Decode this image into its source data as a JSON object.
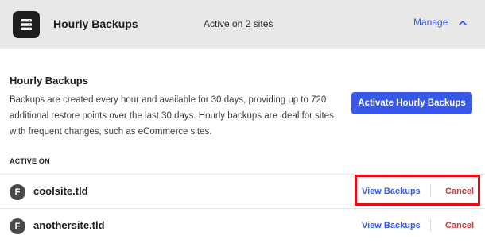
{
  "header": {
    "icon": "server-stack-icon",
    "title": "Hourly Backups",
    "active_summary": "Active on 2 sites",
    "manage_label": "Manage",
    "manage_icon": "chevron-up-icon"
  },
  "description": {
    "title": "Hourly Backups",
    "text": "Backups are created every hour and available for 30 days, providing up to 720 additional restore points over the last 30 days. Hourly backups are ideal for sites with frequent changes, such as eCommerce sites.",
    "activate_label": "Activate Hourly Backups"
  },
  "active_on": {
    "label": "ACTIVE ON",
    "sites": [
      {
        "avatar": "F",
        "name": "coolsite.tld",
        "view_label": "View Backups",
        "cancel_label": "Cancel"
      },
      {
        "avatar": "F",
        "name": "anothersite.tld",
        "view_label": "View Backups",
        "cancel_label": "Cancel"
      }
    ]
  },
  "colors": {
    "accent": "#3858e9",
    "danger": "#d63638",
    "highlight": "#e2101b",
    "header_bg": "#e8e8e8"
  }
}
